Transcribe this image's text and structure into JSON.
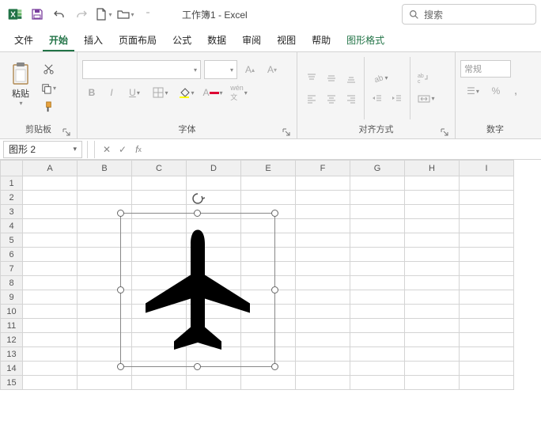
{
  "title": "工作簿1 - Excel",
  "search_placeholder": "搜索",
  "tabs": {
    "file": "文件",
    "home": "开始",
    "insert": "插入",
    "layout": "页面布局",
    "formulas": "公式",
    "data": "数据",
    "review": "审阅",
    "view": "视图",
    "help": "帮助",
    "shapeformat": "图形格式"
  },
  "ribbon": {
    "clipboard": {
      "paste": "粘贴",
      "label": "剪贴板"
    },
    "font": {
      "label": "字体"
    },
    "align": {
      "label": "对齐方式"
    },
    "number": {
      "label": "数字",
      "format": "常规"
    }
  },
  "namebox": "图形 2",
  "columns": [
    "A",
    "B",
    "C",
    "D",
    "E",
    "F",
    "G",
    "H",
    "I"
  ],
  "rows": [
    "1",
    "2",
    "3",
    "4",
    "5",
    "6",
    "7",
    "8",
    "9",
    "10",
    "11",
    "12",
    "13",
    "14",
    "15"
  ],
  "shape": {
    "name": "airplane"
  }
}
